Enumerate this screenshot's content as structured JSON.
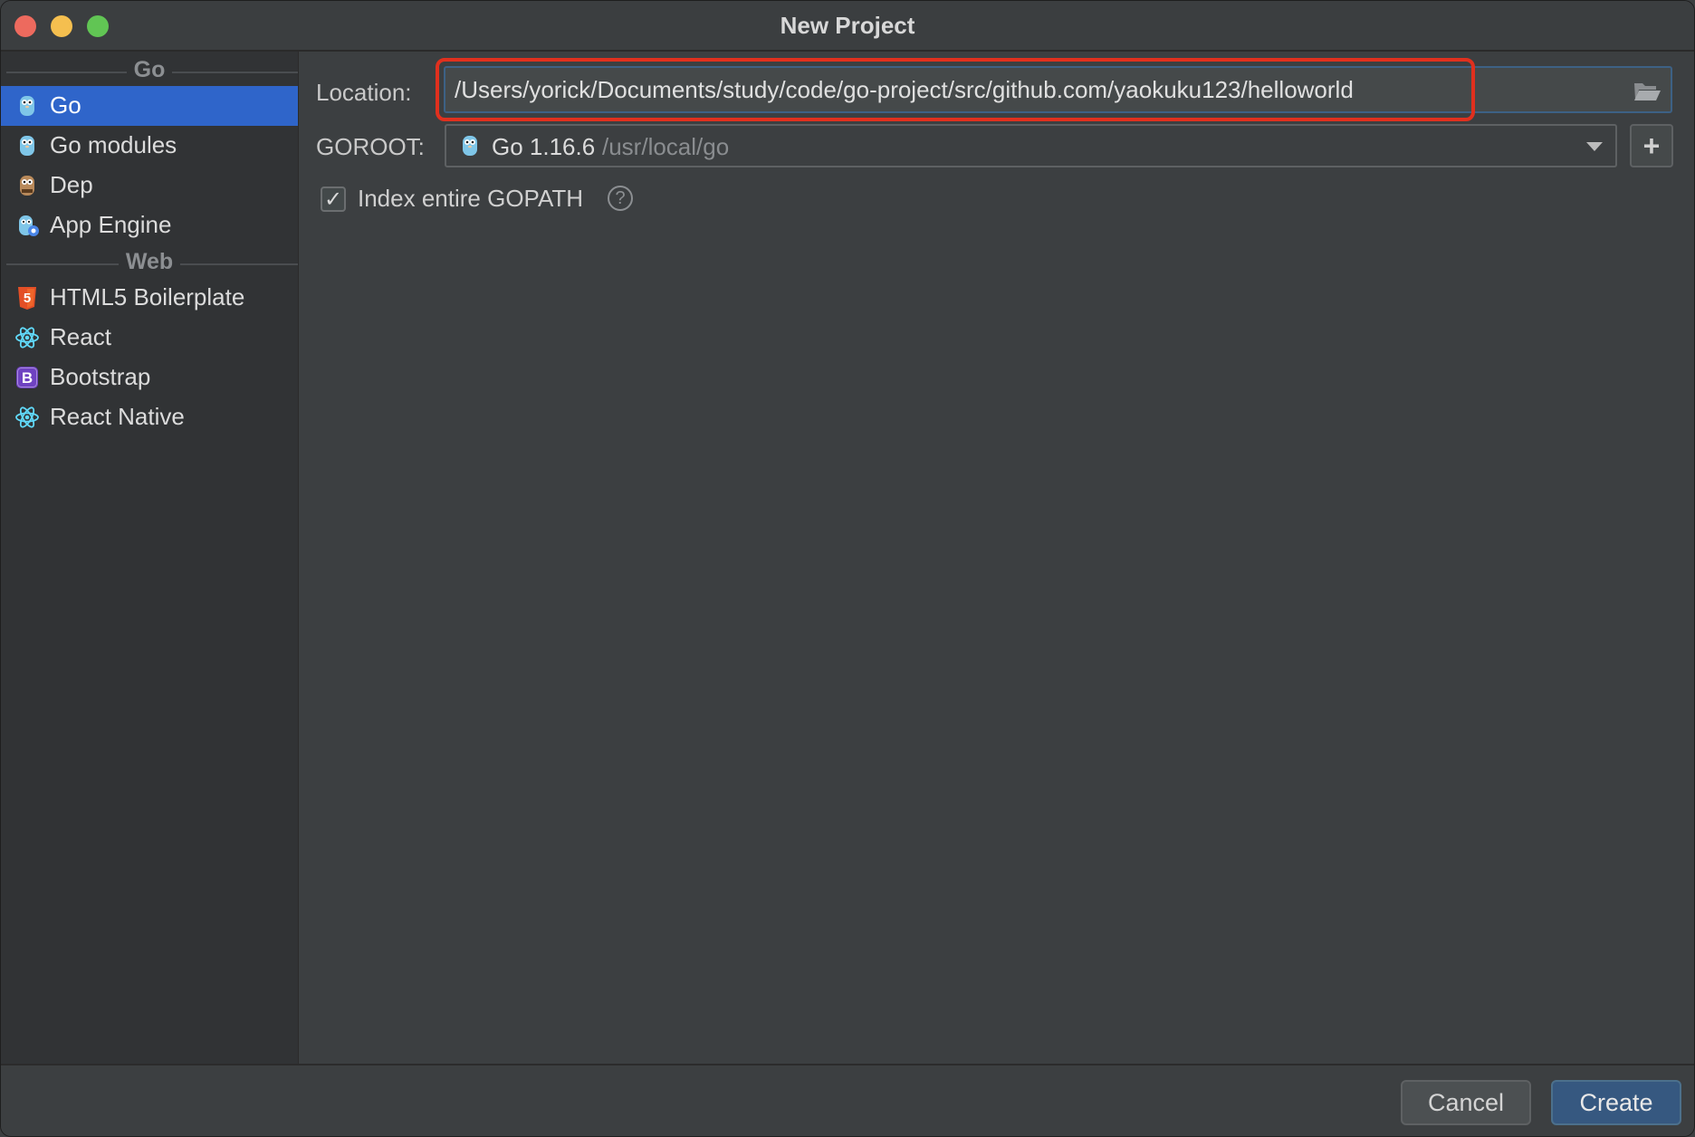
{
  "window": {
    "title": "New Project"
  },
  "sidebar": {
    "groups": [
      {
        "label": "Go",
        "items": [
          {
            "label": "Go",
            "icon": "gopher-icon",
            "selected": true
          },
          {
            "label": "Go modules",
            "icon": "gopher-icon"
          },
          {
            "label": "Dep",
            "icon": "dep-gopher-icon"
          },
          {
            "label": "App Engine",
            "icon": "app-engine-gopher-icon"
          }
        ]
      },
      {
        "label": "Web",
        "items": [
          {
            "label": "HTML5 Boilerplate",
            "icon": "html5-icon"
          },
          {
            "label": "React",
            "icon": "react-icon"
          },
          {
            "label": "Bootstrap",
            "icon": "bootstrap-icon"
          },
          {
            "label": "React Native",
            "icon": "react-icon"
          }
        ]
      }
    ]
  },
  "form": {
    "location_label": "Location:",
    "location_value": "/Users/yorick/Documents/study/code/go-project/src/github.com/yaokuku123/helloworld",
    "goroot_label": "GOROOT:",
    "goroot_version": "Go 1.16.6",
    "goroot_path": "/usr/local/go",
    "add_sdk_glyph": "+",
    "index_gopath_label": "Index entire GOPATH",
    "index_gopath_checked": true,
    "help_glyph": "?"
  },
  "footer": {
    "cancel_label": "Cancel",
    "create_label": "Create"
  },
  "colors": {
    "selection": "#2f65ca",
    "highlight": "#e0301e",
    "primary_button": "#365880"
  }
}
